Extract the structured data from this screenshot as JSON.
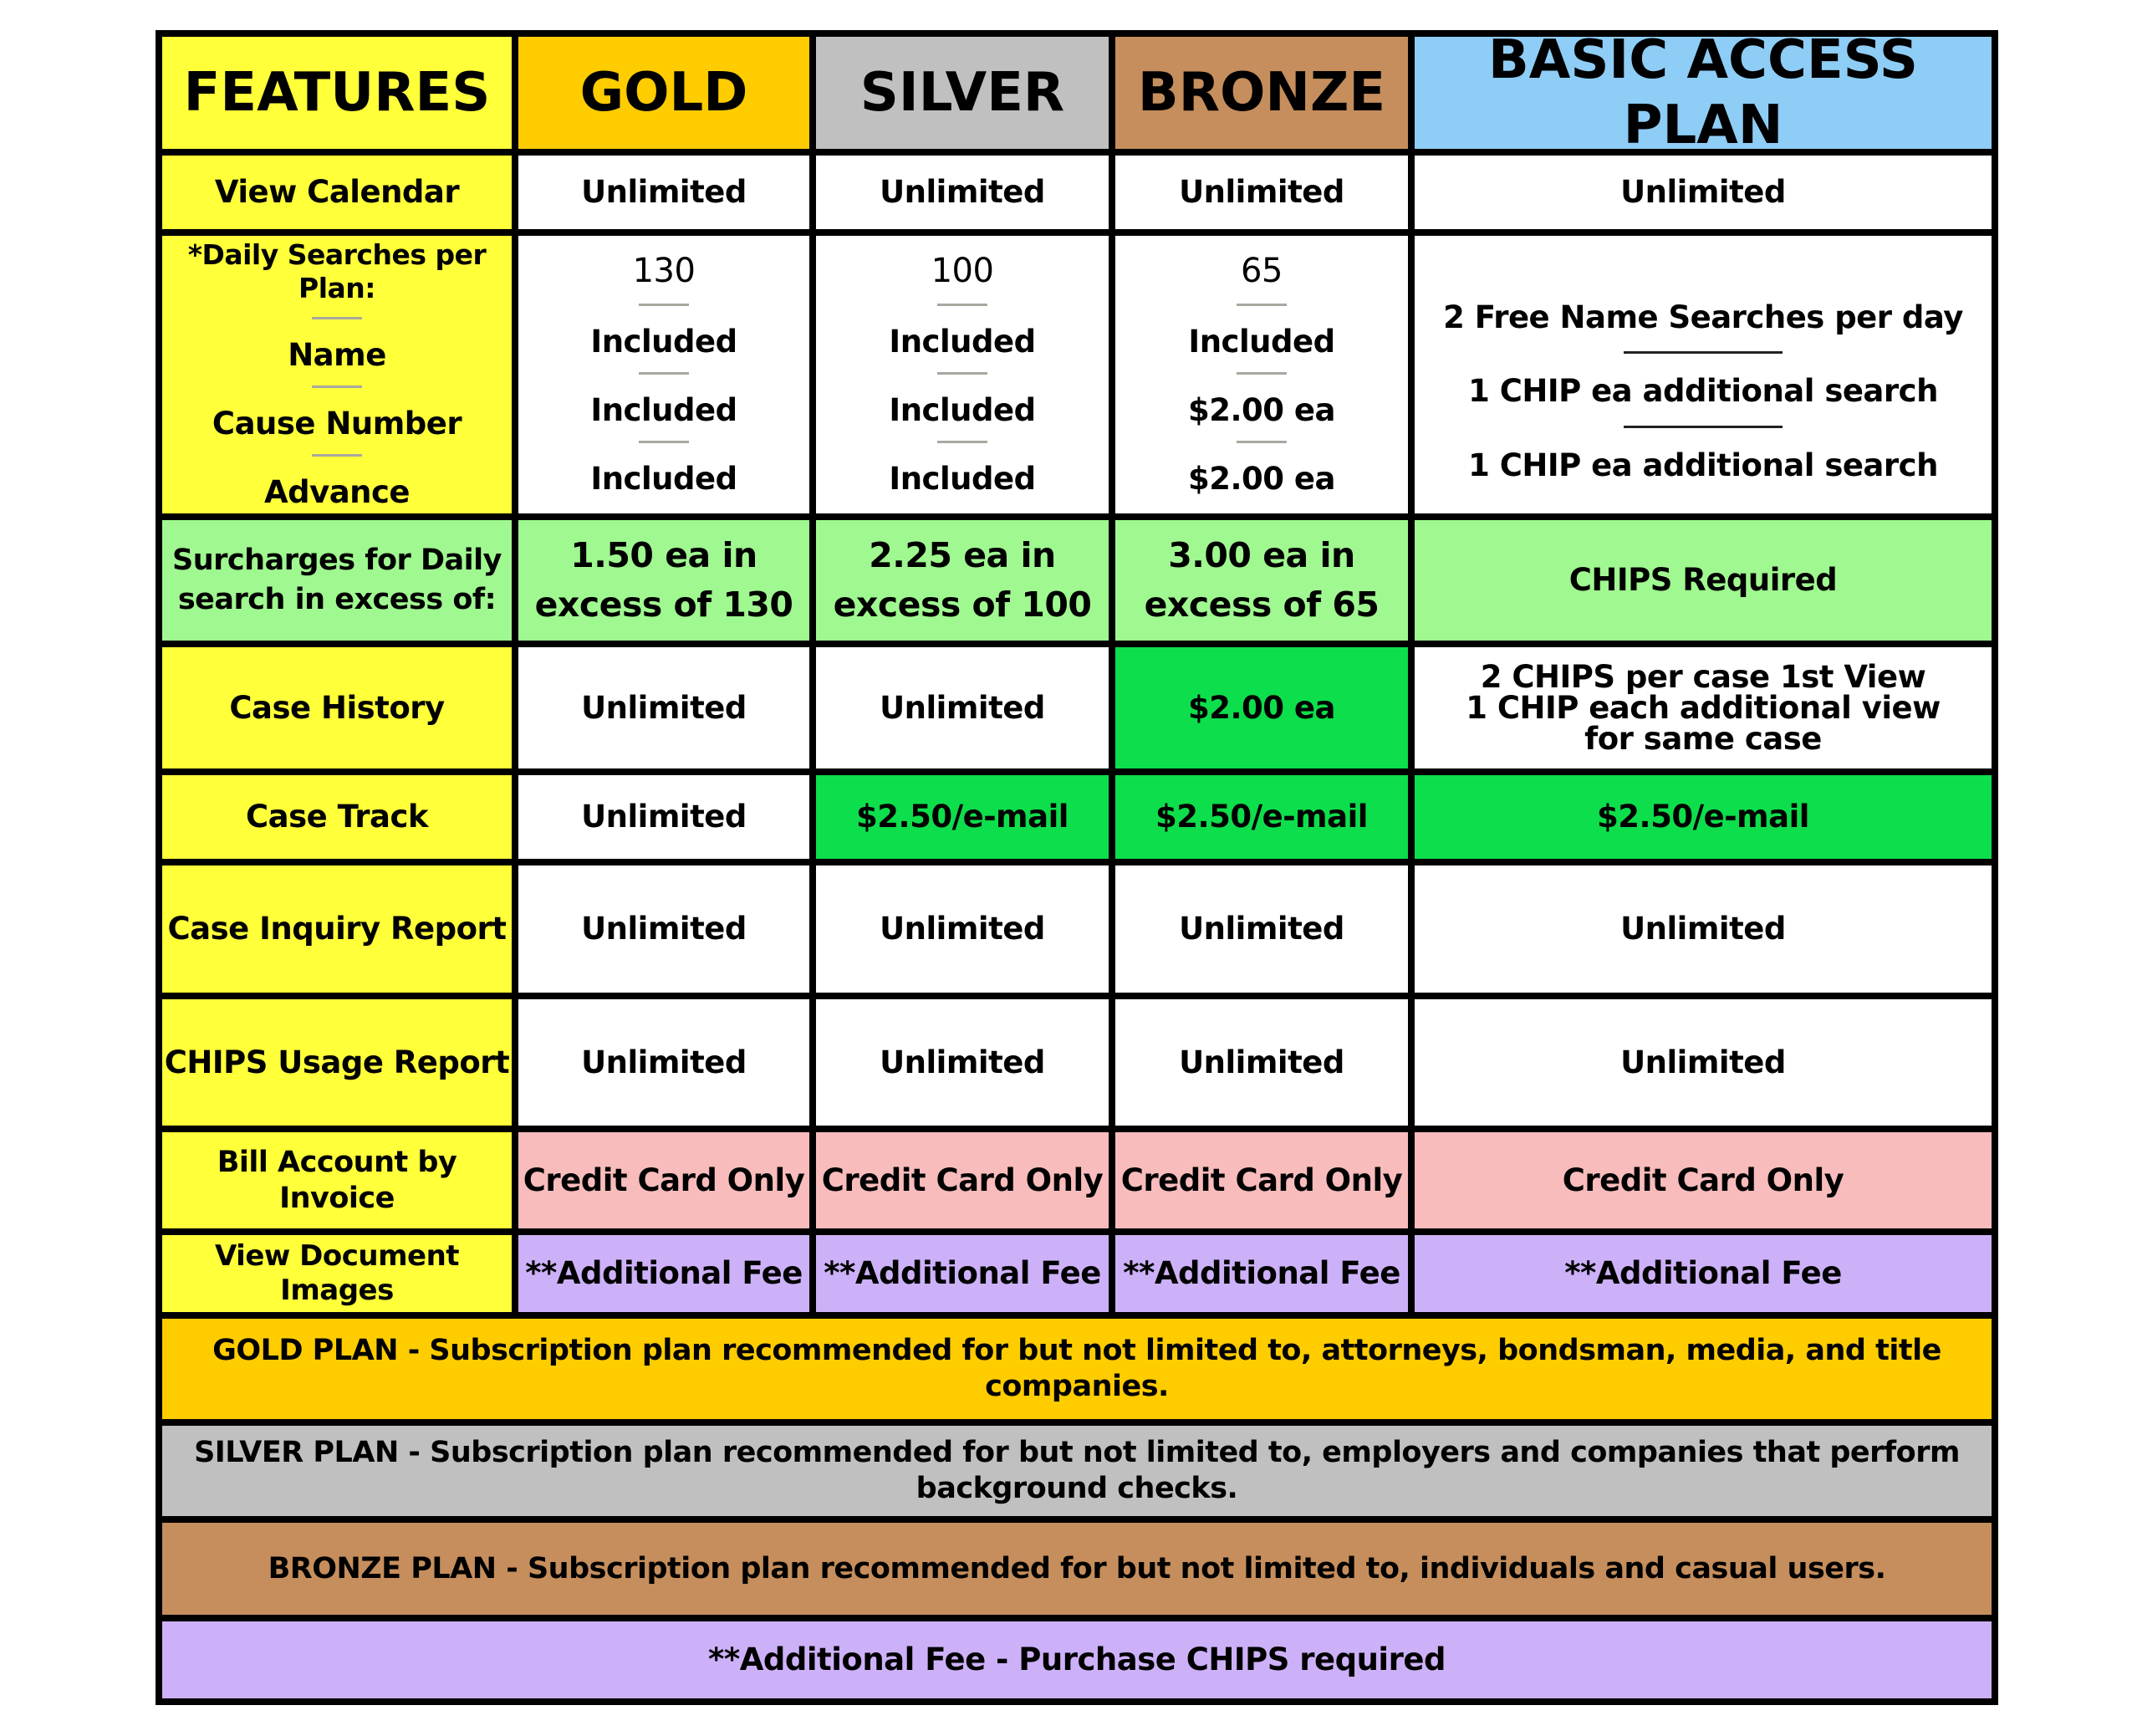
{
  "headers": {
    "features": "FEATURES",
    "gold": "GOLD",
    "silver": "SILVER",
    "bronze": "BRONZE",
    "basic": "BASIC ACCESS PLAN"
  },
  "colors": {
    "features": "#FFFF3A",
    "gold": "#FFCC00",
    "silver": "#C0C0C0",
    "bronze": "#C68E5C",
    "basic": "#8ECDF5",
    "surcharge": "#A0F890",
    "fee_highlight": "#0DDE4B",
    "billing": "#F8BCBC",
    "additional_fee": "#CDB1F8"
  },
  "rows": {
    "view_calendar": {
      "label": "View Calendar",
      "gold": "Unlimited",
      "silver": "Unlimited",
      "bronze": "Unlimited",
      "basic": "Unlimited"
    },
    "daily_searches": {
      "label": "*Daily Searches per Plan:",
      "sub_labels": [
        "Name",
        "Cause Number",
        "Advance"
      ],
      "gold": {
        "count": "130",
        "name": "Included",
        "cause": "Included",
        "advance": "Included"
      },
      "silver": {
        "count": "100",
        "name": "Included",
        "cause": "Included",
        "advance": "Included"
      },
      "bronze": {
        "count": "65",
        "name": "Included",
        "cause": "$2.00 ea",
        "advance": "$2.00 ea"
      },
      "basic": {
        "name": "2 Free Name Searches per day",
        "cause": "1 CHIP ea additional search",
        "advance": "1 CHIP ea additional search"
      }
    },
    "surcharges": {
      "label_lines": [
        "Surcharges for Daily",
        "search in excess of:"
      ],
      "gold": [
        "1.50 ea in",
        "excess of 130"
      ],
      "silver": [
        "2.25 ea in",
        "excess of 100"
      ],
      "bronze": [
        "3.00 ea in",
        "excess of 65"
      ],
      "basic": "CHIPS Required"
    },
    "case_history": {
      "label": "Case History",
      "gold": "Unlimited",
      "silver": "Unlimited",
      "bronze": "$2.00 ea",
      "basic": [
        "2 CHIPS per case 1st View",
        "1 CHIP each additional view",
        "for same case"
      ]
    },
    "case_track": {
      "label": "Case Track",
      "gold": "Unlimited",
      "silver": "$2.50/e-mail",
      "bronze": "$2.50/e-mail",
      "basic": "$2.50/e-mail"
    },
    "case_inquiry": {
      "label": "Case Inquiry Report",
      "gold": "Unlimited",
      "silver": "Unlimited",
      "bronze": "Unlimited",
      "basic": "Unlimited"
    },
    "chips_usage": {
      "label": "CHIPS Usage Report",
      "gold": "Unlimited",
      "silver": "Unlimited",
      "bronze": "Unlimited",
      "basic": "Unlimited"
    },
    "bill_invoice": {
      "label": "Bill Account by Invoice",
      "gold": "Credit Card Only",
      "silver": "Credit Card Only",
      "bronze": "Credit Card Only",
      "basic": "Credit Card Only"
    },
    "view_documents": {
      "label": "View Document Images",
      "gold": "**Additional Fee",
      "silver": "**Additional Fee",
      "bronze": "**Additional Fee",
      "basic": "**Additional Fee"
    }
  },
  "footnotes": {
    "gold": "GOLD PLAN - Subscription plan recommended for but not limited to, attorneys, bondsman, media, and title companies.",
    "silver": "SILVER PLAN - Subscription plan recommended for but not limited to, employers and companies that perform background checks.",
    "bronze": "BRONZE PLAN - Subscription plan recommended for but not limited to, individuals and casual users.",
    "additional_fee": "**Additional Fee - Purchase CHIPS required"
  }
}
